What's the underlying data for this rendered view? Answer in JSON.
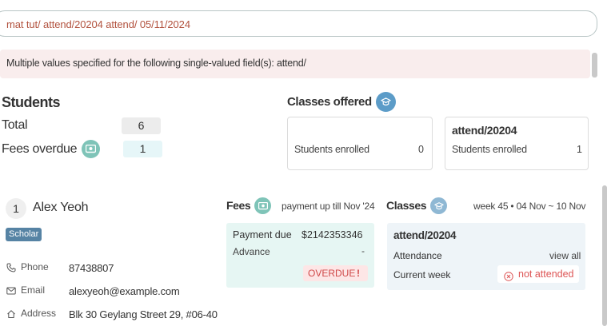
{
  "command": {
    "value": "mat tut/ attend/20204 attend/ 05/11/2024"
  },
  "error": {
    "message": "Multiple values specified for the following single-valued field(s): attend/"
  },
  "students": {
    "title": "Students",
    "total_label": "Total",
    "total_value": "6",
    "fees_overdue_label": "Fees overdue",
    "fees_overdue_value": "1"
  },
  "classes_offered": {
    "title": "Classes offered",
    "cards": [
      {
        "title": "",
        "label": "Students enrolled",
        "value": "0"
      },
      {
        "title": "attend/20204",
        "label": "Students enrolled",
        "value": "1"
      }
    ]
  },
  "person": {
    "index": "1",
    "name": "Alex Yeoh",
    "tag": "Scholar",
    "phone_label": "Phone",
    "phone": "87438807",
    "email_label": "Email",
    "email": "alexyeoh@example.com",
    "address_label": "Address",
    "address": "Blk 30 Geylang Street 29, #06-40"
  },
  "fees": {
    "title": "Fees",
    "subtitle": "payment up till Nov '24",
    "payment_due_label": "Payment due",
    "payment_due_value": "$2142353346",
    "advance_label": "Advance",
    "advance_value": "-",
    "status": "OVERDUE",
    "status_mark": "!"
  },
  "classes": {
    "title": "Classes",
    "week": "week 45 • 04 Nov ~ 10 Nov",
    "class_name": "attend/20204",
    "attendance_label": "Attendance",
    "view_all": "view all",
    "current_week_label": "Current week",
    "current_week_status": "not attended"
  },
  "colors": {
    "command_text": "#b2523e",
    "error_bg": "#f9eded",
    "fees_bg": "#e6f6f3",
    "classes_bg": "#eef4f8",
    "overdue_text": "#d04a4a",
    "tag_bg": "#5683a4"
  },
  "icons": [
    "money-icon",
    "graduation-cap-icon",
    "phone-icon",
    "mail-icon",
    "home-icon",
    "x-circle-icon"
  ]
}
